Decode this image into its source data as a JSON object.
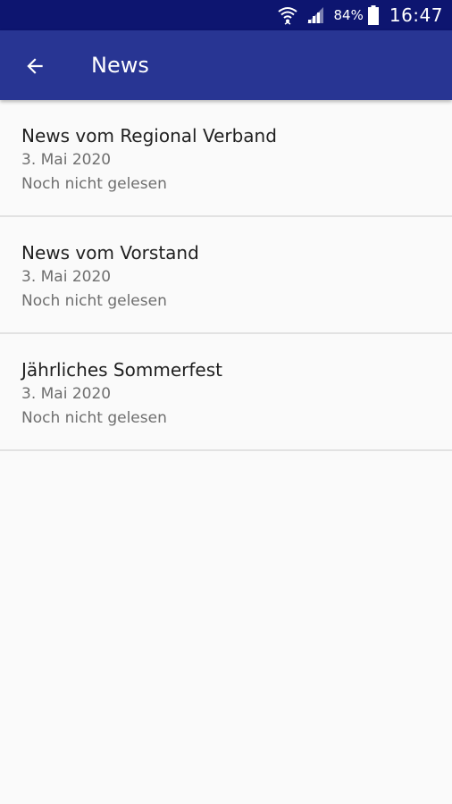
{
  "status_bar": {
    "battery_percent": "84%",
    "time": "16:47",
    "icons": [
      "wifi-icon",
      "signal-icon",
      "battery-icon"
    ]
  },
  "app_bar": {
    "title": "News",
    "back_icon": "arrow-back-icon"
  },
  "colors": {
    "status_bar": "#0d1570",
    "app_bar": "#283593",
    "background": "#fafafa",
    "divider": "#e2e2e2",
    "title_text": "#1f1f1f",
    "secondary_text": "#6f6f6f"
  },
  "news": {
    "items": [
      {
        "title": "News vom Regional Verband",
        "date": "3. Mai 2020",
        "status": "Noch nicht gelesen"
      },
      {
        "title": "News vom Vorstand",
        "date": "3. Mai 2020",
        "status": "Noch nicht gelesen"
      },
      {
        "title": "Jährliches Sommerfest",
        "date": "3. Mai 2020",
        "status": "Noch nicht gelesen"
      }
    ]
  }
}
